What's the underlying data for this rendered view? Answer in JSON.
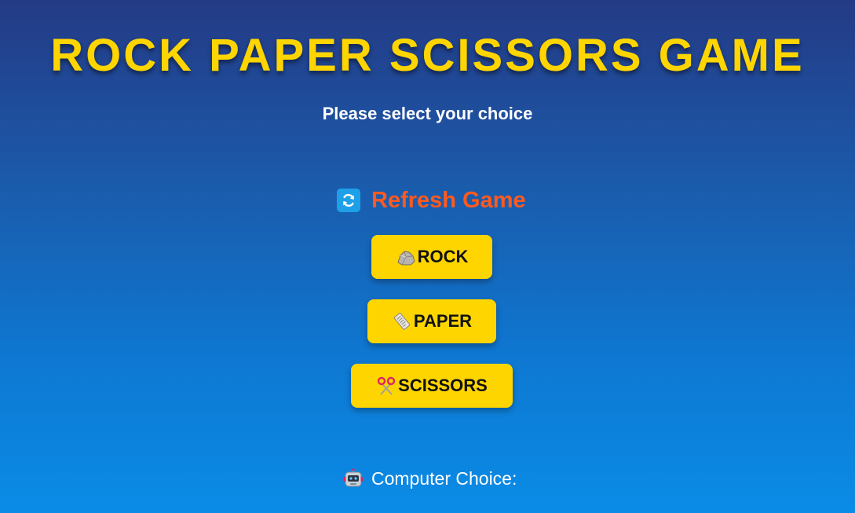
{
  "page": {
    "title": "ROCK PAPER SCISSORS GAME",
    "subtitle": "Please select your choice"
  },
  "refresh": {
    "label": "Refresh Game",
    "icon": "refresh-icon"
  },
  "choices": [
    {
      "label": "ROCK",
      "icon": "rock-icon"
    },
    {
      "label": "PAPER",
      "icon": "newspaper-icon"
    },
    {
      "label": "SCISSORS",
      "icon": "scissors-icon"
    }
  ],
  "computer": {
    "label": "Computer Choice:",
    "icon": "robot-icon"
  },
  "colors": {
    "title": "#ffd500",
    "button_bg": "#ffd500",
    "refresh_text": "#ff5a1f",
    "refresh_icon_bg": "#1ea0e8"
  }
}
